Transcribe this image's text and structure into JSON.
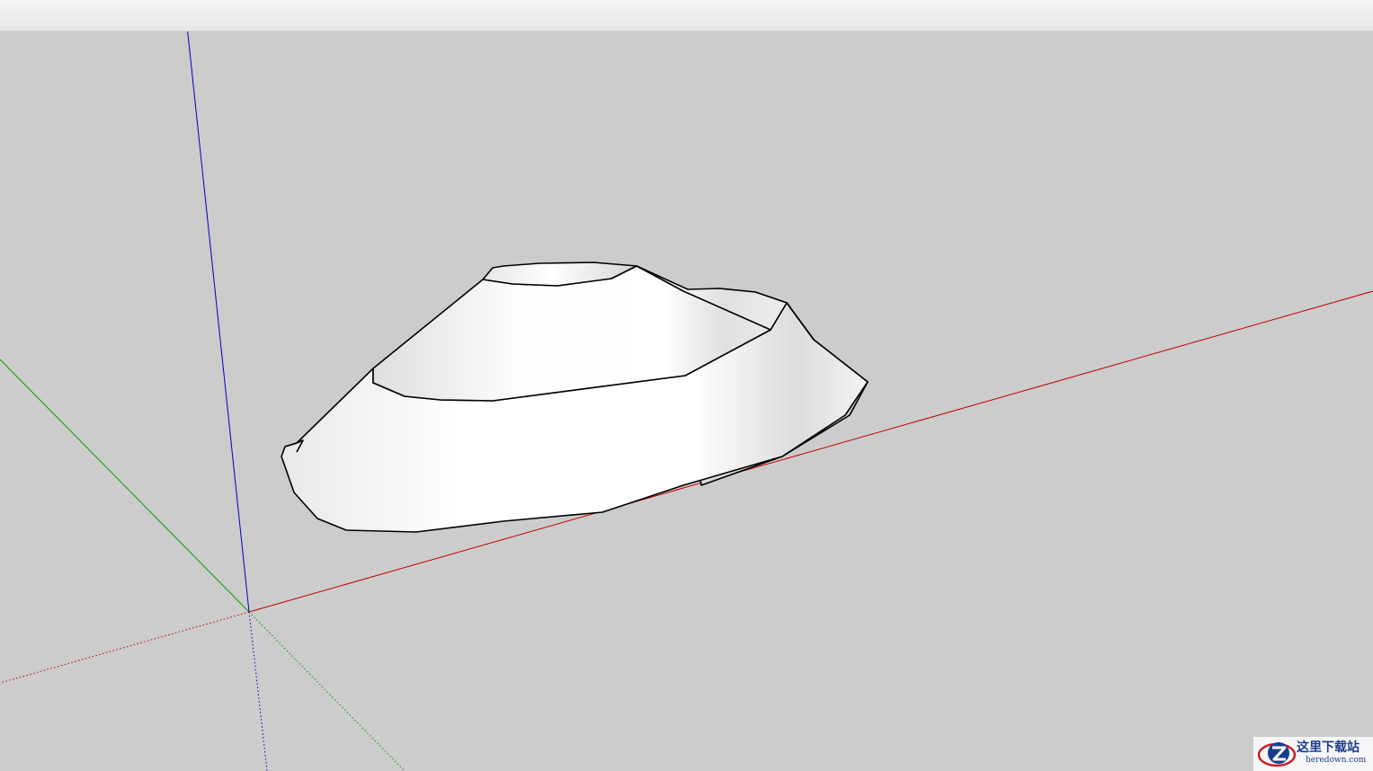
{
  "toolbar": {
    "style": "empty-toolbar-strip"
  },
  "viewport": {
    "background_color": "#cccccc",
    "axes": {
      "red_axis_color": "#c00000",
      "green_axis_color": "#00a000",
      "blue_axis_color": "#0000c0"
    },
    "model": {
      "description_icon": "3d-mound-model-icon",
      "fill_color": "#ffffff",
      "edge_color": "#000000"
    }
  },
  "watermark": {
    "title": "这里下载站",
    "url": "heredown.com",
    "logo_icon": "heredown-z-logo-icon",
    "color": "#1b3c8c"
  }
}
